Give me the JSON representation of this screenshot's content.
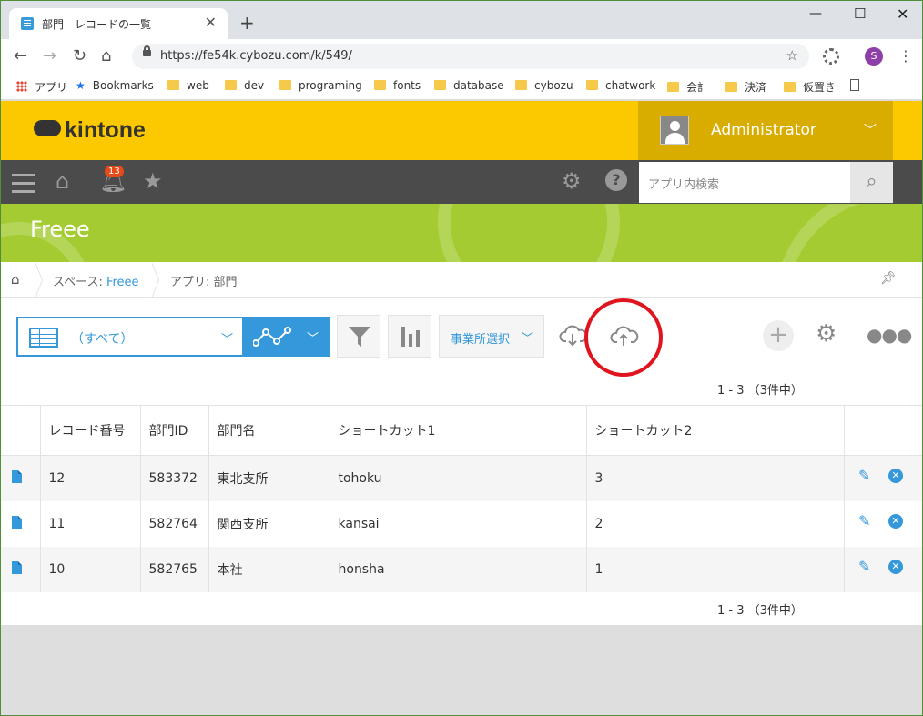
{
  "browser": {
    "tab_title": "部門 - レコードの一覧",
    "url": "https://fe54k.cybozu.com/k/549/",
    "profile_initial": "S",
    "bookmarks": [
      "アプリ",
      "Bookmarks",
      "web",
      "dev",
      "programing",
      "fonts",
      "database",
      "cybozu",
      "chatwork",
      "会計",
      "決済",
      "仮置き"
    ]
  },
  "header": {
    "logo": "kintone",
    "user": "Administrator",
    "notification_count": "13",
    "search_placeholder": "アプリ内検索"
  },
  "app": {
    "name": "Freee"
  },
  "breadcrumb": {
    "space_prefix": "スペース: ",
    "space_name": "Freee",
    "app_label": "アプリ: 部門"
  },
  "toolbar": {
    "view_label": "（すべて）",
    "office_select": "事業所選択",
    "pager_top": "1 - 3 （3件中）",
    "pager_bottom": "1 - 3 （3件中）"
  },
  "table": {
    "columns": [
      "レコード番号",
      "部門ID",
      "部門名",
      "ショートカット1",
      "ショートカット2"
    ],
    "rows": [
      {
        "no": "12",
        "id": "583372",
        "name": "東北支所",
        "sc1": "tohoku",
        "sc2": "3"
      },
      {
        "no": "11",
        "id": "582764",
        "name": "関西支所",
        "sc1": "kansai",
        "sc2": "2"
      },
      {
        "no": "10",
        "id": "582765",
        "name": "本社",
        "sc1": "honsha",
        "sc2": "1"
      }
    ]
  },
  "colors": {
    "header": "#fcc800",
    "banner": "#a4cc32",
    "accent": "#3498db",
    "highlight": "#e0141f"
  }
}
